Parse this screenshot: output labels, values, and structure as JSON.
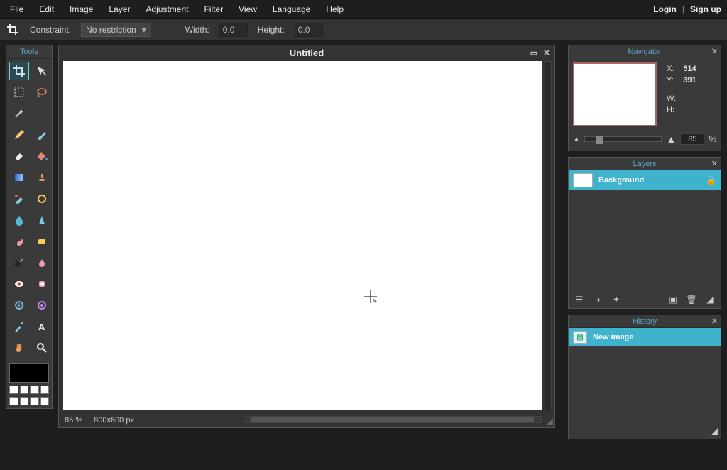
{
  "menu": {
    "items": [
      "File",
      "Edit",
      "Image",
      "Layer",
      "Adjustment",
      "Filter",
      "View",
      "Language",
      "Help"
    ]
  },
  "auth": {
    "login": "Login",
    "signup": "Sign up"
  },
  "options": {
    "constraint_label": "Constraint:",
    "constraint_value": "No restriction",
    "width_label": "Width:",
    "width_value": "0.0",
    "height_label": "Height:",
    "height_value": "0.0"
  },
  "tools": {
    "title": "Tools",
    "items": [
      "crop",
      "move",
      "marquee",
      "lasso",
      "wand",
      "",
      "pencil",
      "brush",
      "eraser",
      "paint-bucket",
      "gradient",
      "clone-stamp",
      "color-replace",
      "color-picker",
      "blur",
      "sharpen",
      "smudge",
      "sponge",
      "dodge",
      "burn",
      "red-eye",
      "spot-heal",
      "bloat",
      "pinch",
      "drawing",
      "type",
      "hand",
      "zoom"
    ]
  },
  "canvas": {
    "title": "Untitled",
    "zoom": "85",
    "zoom_pct_label": "%",
    "dimensions": "800x600 px"
  },
  "navigator": {
    "title": "Navigator",
    "x_label": "X:",
    "x_value": "514",
    "y_label": "Y:",
    "y_value": "391",
    "w_label": "W:",
    "w_value": "",
    "h_label": "H:",
    "h_value": "",
    "zoom": "85",
    "pct": "%"
  },
  "layers": {
    "title": "Layers",
    "items": [
      {
        "name": "Background",
        "locked": true
      }
    ]
  },
  "history": {
    "title": "History",
    "items": [
      {
        "name": "New image"
      }
    ]
  }
}
